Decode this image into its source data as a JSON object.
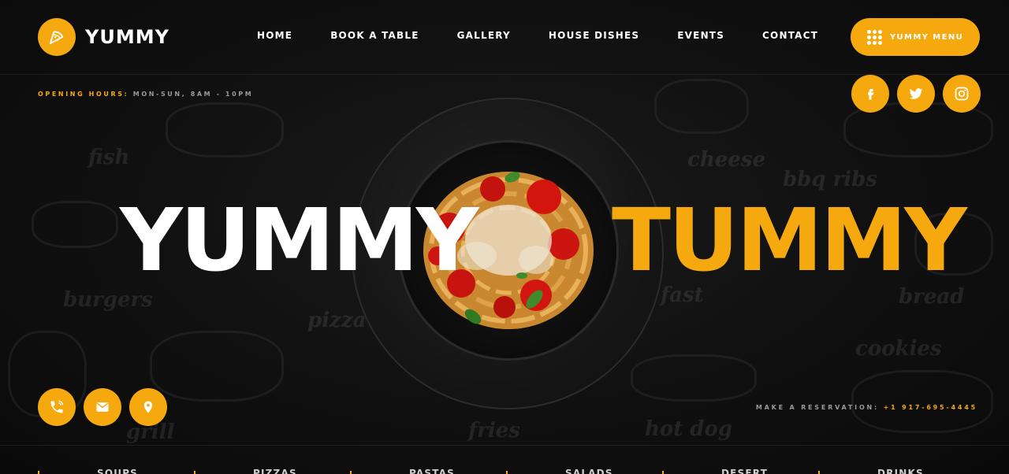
{
  "brand": {
    "name": "YUMMY",
    "accent": "#f5a90e",
    "logo_icon": "pizza-slice-icon"
  },
  "nav": {
    "items": [
      {
        "label": "HOME"
      },
      {
        "label": "BOOK A TABLE"
      },
      {
        "label": "GALLERY"
      },
      {
        "label": "HOUSE DISHES"
      },
      {
        "label": "EVENTS"
      },
      {
        "label": "CONTACT"
      }
    ]
  },
  "menu_button": {
    "label": "YUMMY MENU",
    "icon": "grid-dots-icon"
  },
  "hours": {
    "label": "OPENING HOURS:",
    "value": "MON-SUN, 8AM - 10PM"
  },
  "social": [
    {
      "name": "facebook",
      "icon": "facebook-icon"
    },
    {
      "name": "twitter",
      "icon": "twitter-icon"
    },
    {
      "name": "instagram",
      "icon": "instagram-icon"
    }
  ],
  "hero": {
    "left_word": "YUMMY",
    "right_word": "TUMMY"
  },
  "contact_icons": [
    {
      "icon": "phone-icon"
    },
    {
      "icon": "mail-icon"
    },
    {
      "icon": "location-pin-icon"
    }
  ],
  "reservation": {
    "label": "MAKE A RESERVATION:",
    "phone": "+1 917-695-4445"
  },
  "background_doodles": [
    "fish",
    "cheese",
    "bbq ribs",
    "burgers",
    "pizza",
    "bread",
    "cookies",
    "fries",
    "hot dog",
    "grill",
    "fast"
  ],
  "categories": [
    {
      "label": "SOUPS"
    },
    {
      "label": "PIZZAS"
    },
    {
      "label": "PASTAS"
    },
    {
      "label": "SALADS"
    },
    {
      "label": "DESERT"
    },
    {
      "label": "DRINKS"
    }
  ]
}
